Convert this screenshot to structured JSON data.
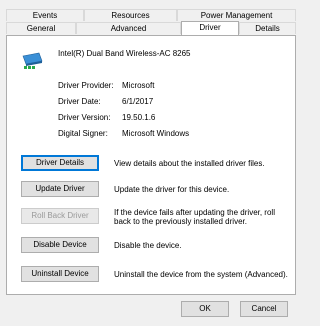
{
  "tabs_row1": [
    "Events",
    "Resources",
    "Power Management"
  ],
  "tabs_row2": [
    "General",
    "Advanced",
    "Driver",
    "Details"
  ],
  "active_tab": "Driver",
  "device": {
    "name": "Intel(R) Dual Band Wireless-AC 8265",
    "icon": "network-adapter-icon"
  },
  "info": {
    "provider_label": "Driver Provider:",
    "provider_value": "Microsoft",
    "date_label": "Driver Date:",
    "date_value": "6/1/2017",
    "version_label": "Driver Version:",
    "version_value": "19.50.1.6",
    "signer_label": "Digital Signer:",
    "signer_value": "Microsoft Windows"
  },
  "actions": {
    "details_label": "Driver Details",
    "details_desc": "View details about the installed driver files.",
    "update_label": "Update Driver",
    "update_desc": "Update the driver for this device.",
    "rollback_label": "Roll Back Driver",
    "rollback_desc": "If the device fails after updating the driver, roll back to the previously installed driver.",
    "disable_label": "Disable Device",
    "disable_desc": "Disable the device.",
    "uninstall_label": "Uninstall Device",
    "uninstall_desc": "Uninstall the device from the system (Advanced)."
  },
  "footer": {
    "ok_label": "OK",
    "cancel_label": "Cancel"
  }
}
